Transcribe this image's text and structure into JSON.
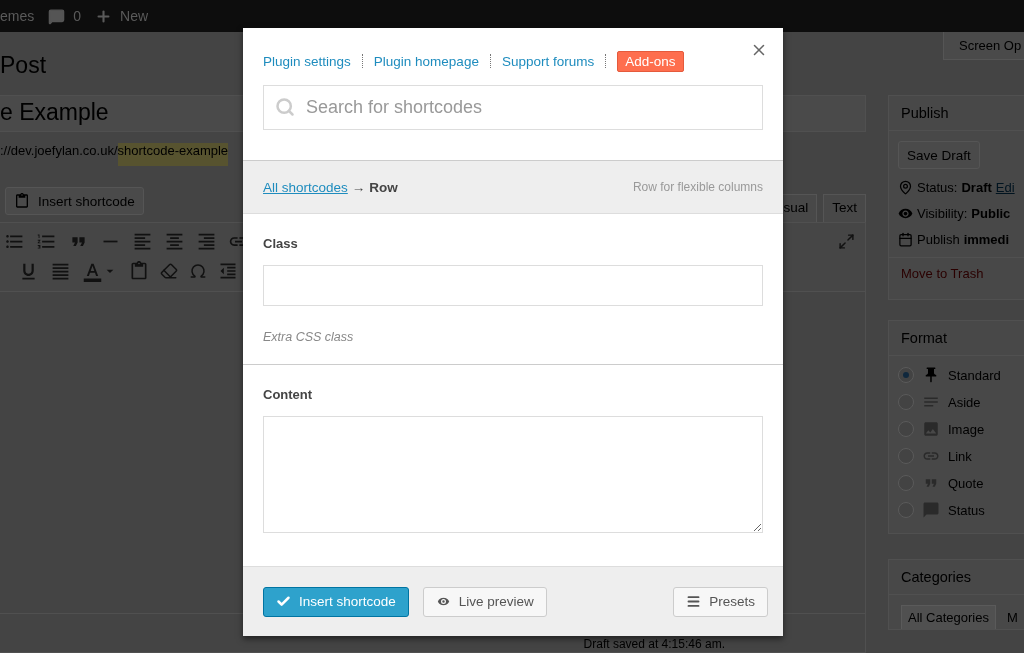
{
  "admin_bar": {
    "items": [
      {
        "kind": "text",
        "label": "emes"
      },
      {
        "kind": "comments",
        "label": "0"
      },
      {
        "kind": "new",
        "label": "New"
      }
    ]
  },
  "page_title": "Post",
  "post_title": "e Example",
  "permalink": {
    "prefix": "://dev.joefylan.co.uk/",
    "slug": "shortcode-example"
  },
  "editor": {
    "insert_button": "Insert shortcode",
    "tabs": [
      {
        "label": "sual",
        "selected": false
      },
      {
        "label": "Text",
        "selected": false
      }
    ],
    "status": "Draft saved at 4:15:46 am."
  },
  "screen_options": "Screen Op",
  "publish": {
    "title": "Publish",
    "save_draft": "Save Draft",
    "lines": [
      {
        "kind": "status",
        "label": "Status:",
        "value": "Draft",
        "link": "Edi"
      },
      {
        "kind": "visibility",
        "label": "Visibility:",
        "value": "Public"
      },
      {
        "kind": "schedule",
        "label": "Publish",
        "value": "immedi"
      }
    ],
    "trash": "Move to Trash"
  },
  "format": {
    "title": "Format",
    "options": [
      {
        "label": "Standard",
        "selected": true
      },
      {
        "label": "Aside",
        "selected": false
      },
      {
        "label": "Image",
        "selected": false
      },
      {
        "label": "Link",
        "selected": false
      },
      {
        "label": "Quote",
        "selected": false
      },
      {
        "label": "Status",
        "selected": false
      }
    ]
  },
  "categories": {
    "title": "Categories",
    "tabs": [
      {
        "label": "All Categories",
        "selected": true
      },
      {
        "label": "M",
        "selected": false
      }
    ]
  },
  "dialog": {
    "links": [
      {
        "label": "Plugin settings",
        "kind": "link"
      },
      {
        "label": "Plugin homepage",
        "kind": "link"
      },
      {
        "label": "Support forums",
        "kind": "link"
      },
      {
        "label": "Add-ons",
        "kind": "badge"
      }
    ],
    "search": {
      "placeholder": "Search for shortcodes"
    },
    "breadcrumb": {
      "parent": "All shortcodes",
      "arrow": "→",
      "current": "Row",
      "description": "Row for flexible columns"
    },
    "fields": [
      {
        "kind": "input",
        "label": "Class",
        "description": "Extra CSS class"
      },
      {
        "kind": "textarea",
        "label": "Content"
      }
    ],
    "buttons": [
      {
        "kind": "primary",
        "label": "Insert shortcode"
      },
      {
        "kind": "preview",
        "label": "Live preview"
      },
      {
        "kind": "presets",
        "label": "Presets"
      }
    ]
  }
}
